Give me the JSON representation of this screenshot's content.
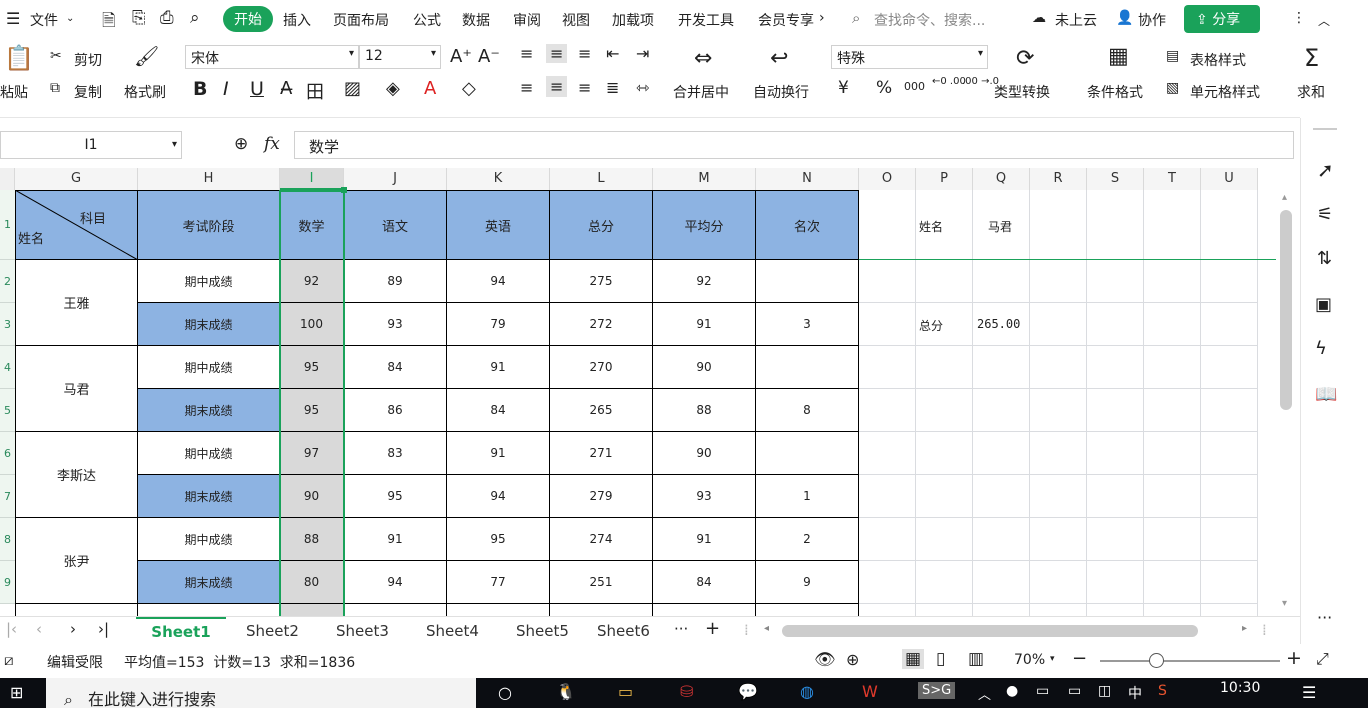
{
  "menubar": {
    "file": "文件",
    "tabs": [
      "开始",
      "插入",
      "页面布局",
      "公式",
      "数据",
      "审阅",
      "视图",
      "加载项",
      "开发工具",
      "会员专享"
    ],
    "search_placeholder": "查找命令、搜索...",
    "cloud": "未上云",
    "collab": "协作",
    "share": "分享"
  },
  "ribbon": {
    "paste": "粘贴",
    "cut": "剪切",
    "copy": "复制",
    "format_painter": "格式刷",
    "font_name": "宋体",
    "font_size": "12",
    "merge": "合并居中",
    "wrap": "自动换行",
    "number_format": "特殊",
    "convert": "类型转换",
    "cond_format": "条件格式",
    "table_style": "表格样式",
    "cell_style": "单元格样式",
    "sum": "求和",
    "bold": "B",
    "italic": "I",
    "underline": "U",
    "currency": "¥",
    "percent": "%",
    "thousand": "000",
    "inc_dec": "←0 .00",
    "dec_dec": ".00 →.0"
  },
  "formula_bar": {
    "name_box": "I1",
    "fx": "fx",
    "content": "数学"
  },
  "columns": [
    "G",
    "H",
    "I",
    "J",
    "K",
    "L",
    "M",
    "N",
    "O",
    "P",
    "Q",
    "R",
    "S",
    "T",
    "U"
  ],
  "row_numbers": [
    "1",
    "2",
    "3",
    "4",
    "5",
    "6",
    "7",
    "8",
    "9"
  ],
  "header": {
    "diag_top": "科目",
    "diag_bottom": "姓名",
    "stage": "考试阶段",
    "cols": [
      "数学",
      "语文",
      "英语",
      "总分",
      "平均分",
      "名次"
    ]
  },
  "students": [
    {
      "name": "王雅",
      "rows": [
        {
          "stage": "期中成绩",
          "vals": [
            "92",
            "89",
            "94",
            "275",
            "92",
            ""
          ]
        },
        {
          "stage": "期末成绩",
          "vals": [
            "100",
            "93",
            "79",
            "272",
            "91",
            "3"
          ]
        }
      ]
    },
    {
      "name": "马君",
      "rows": [
        {
          "stage": "期中成绩",
          "vals": [
            "95",
            "84",
            "91",
            "270",
            "90",
            ""
          ]
        },
        {
          "stage": "期末成绩",
          "vals": [
            "95",
            "86",
            "84",
            "265",
            "88",
            "8"
          ]
        }
      ]
    },
    {
      "name": "李斯达",
      "rows": [
        {
          "stage": "期中成绩",
          "vals": [
            "97",
            "83",
            "91",
            "271",
            "90",
            ""
          ]
        },
        {
          "stage": "期末成绩",
          "vals": [
            "90",
            "95",
            "94",
            "279",
            "93",
            "1"
          ]
        }
      ]
    },
    {
      "name": "张尹",
      "rows": [
        {
          "stage": "期中成绩",
          "vals": [
            "88",
            "91",
            "95",
            "274",
            "91",
            "2"
          ]
        },
        {
          "stage": "期末成绩",
          "vals": [
            "80",
            "94",
            "77",
            "251",
            "84",
            "9"
          ]
        }
      ]
    }
  ],
  "side_table": {
    "name_label": "姓名",
    "name_value": "马君",
    "total_label": "总分",
    "total_value": "265.00"
  },
  "sheets": [
    "Sheet1",
    "Sheet2",
    "Sheet3",
    "Sheet4",
    "Sheet5",
    "Sheet6"
  ],
  "status": {
    "mode": "编辑受限",
    "stats": "平均值=153  计数=13  求和=1836",
    "zoom": "70%"
  },
  "taskbar": {
    "search": "在此键入进行搜索",
    "time": "10:30",
    "ime": "中"
  },
  "colors": {
    "accent": "#1aa25a",
    "header_blue": "#8db3e2",
    "selected_col": "#d9d9d9"
  }
}
